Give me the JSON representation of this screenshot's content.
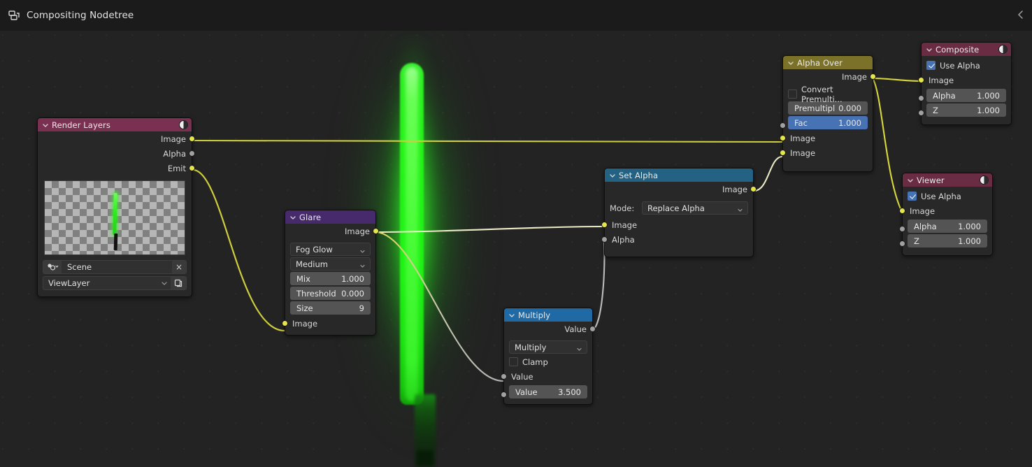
{
  "header": {
    "title": "Compositing Nodetree",
    "icon": "nodetree-icon",
    "collapse_icon": "chevron-left-icon"
  },
  "viewport": {
    "background_color": "#232323",
    "grid_dot_color": "#2e2e2e"
  },
  "nodes": {
    "render_layers": {
      "title": "Render Layers",
      "header_color": "#7a3050",
      "badge_icon": "render-result-icon",
      "outputs": [
        {
          "label": "Image",
          "socket": "image"
        },
        {
          "label": "Alpha",
          "socket": "value"
        },
        {
          "label": "Emit",
          "socket": "image"
        }
      ],
      "scene_label": "Scene",
      "scene_clear": "×",
      "view_layer_label": "ViewLayer"
    },
    "glare": {
      "title": "Glare",
      "header_color": "#462a6b",
      "output_label": "Image",
      "glare_type": "Fog Glow",
      "quality": "Medium",
      "fields": [
        {
          "label": "Mix",
          "value": "1.000"
        },
        {
          "label": "Threshold",
          "value": "0.000"
        },
        {
          "label": "Size",
          "value": "9"
        }
      ],
      "input_label": "Image"
    },
    "multiply": {
      "title": "Multiply",
      "header_color": "#1f6aa5",
      "output_label": "Value",
      "operation": "Multiply",
      "clamp_label": "Clamp",
      "clamp_checked": false,
      "input_value_label": "Value",
      "value_field_label": "Value",
      "value_field_value": "3.500"
    },
    "set_alpha": {
      "title": "Set Alpha",
      "header_color": "#246283",
      "output_label": "Image",
      "mode_label": "Mode:",
      "mode_value": "Replace Alpha",
      "inputs": [
        {
          "label": "Image",
          "socket": "image"
        },
        {
          "label": "Alpha",
          "socket": "value"
        }
      ]
    },
    "alpha_over": {
      "title": "Alpha Over",
      "header_color": "#7b7128",
      "output_label": "Image",
      "convert_premultiply_label": "Convert Premulti...",
      "convert_premultiply_checked": false,
      "premultiply_label": "Premultipl",
      "premultiply_value": "0.000",
      "fac_label": "Fac",
      "fac_value": "1.000",
      "fac_accent_color": "#4772b3",
      "inputs": [
        {
          "label": "Image",
          "socket": "image"
        },
        {
          "label": "Image",
          "socket": "image"
        }
      ]
    },
    "composite": {
      "title": "Composite",
      "header_color": "#6a2c42",
      "badge_icon": "render-result-icon",
      "use_alpha_label": "Use Alpha",
      "use_alpha_checked": true,
      "image_label": "Image",
      "fields": [
        {
          "label": "Alpha",
          "value": "1.000"
        },
        {
          "label": "Z",
          "value": "1.000"
        }
      ]
    },
    "viewer": {
      "title": "Viewer",
      "header_color": "#6a2c42",
      "badge_icon": "render-result-icon",
      "use_alpha_label": "Use Alpha",
      "use_alpha_checked": true,
      "image_label": "Image",
      "fields": [
        {
          "label": "Alpha",
          "value": "1.000"
        },
        {
          "label": "Z",
          "value": "1.000"
        }
      ]
    }
  },
  "sockets": {
    "image_color": "#e5e54b",
    "value_color": "#a1a1a1"
  },
  "links": [
    {
      "from": "render_layers.Image",
      "to": "alpha_over.Image1",
      "color": "#cdcd3f"
    },
    {
      "from": "render_layers.Emit",
      "to": "glare.Image",
      "color": "#cdcd3f"
    },
    {
      "from": "glare.Image",
      "to": "set_alpha.Image",
      "color": "#e8e8c0"
    },
    {
      "from": "glare.Image",
      "to": "multiply.Value",
      "color": "#c9c9a0"
    },
    {
      "from": "multiply.Value",
      "to": "set_alpha.Alpha",
      "color": "#b8b8b8"
    },
    {
      "from": "set_alpha.Image",
      "to": "alpha_over.Image2",
      "color": "#e8e8c0"
    },
    {
      "from": "alpha_over.Image",
      "to": "composite.Image",
      "color": "#d8d83c"
    },
    {
      "from": "alpha_over.Image",
      "to": "viewer.Image",
      "color": "#d8d83c"
    }
  ]
}
